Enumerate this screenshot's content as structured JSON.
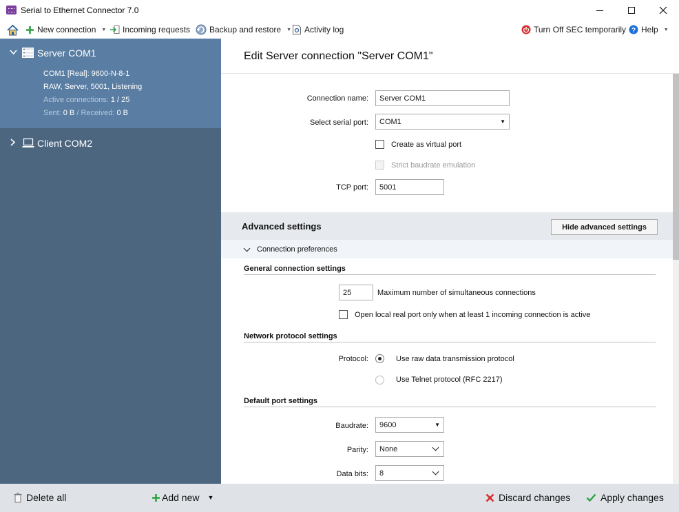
{
  "window": {
    "title": "Serial to Ethernet Connector 7.0"
  },
  "toolbar": {
    "new_connection": "New connection",
    "incoming_requests": "Incoming requests",
    "backup_restore": "Backup and restore",
    "activity_log": "Activity log",
    "turn_off": "Turn Off SEC temporarily",
    "help": "Help"
  },
  "sidebar": {
    "connections": [
      {
        "name": "Server COM1",
        "port_line": "COM1 [Real]: 9600-N-8-1",
        "status_line": "RAW, Server, 5001, Listening",
        "active_label": "Active connections:",
        "active_value": "1 / 25",
        "sent_label": "Sent:",
        "sent_value": "0 B",
        "separator": "/",
        "received_label": "Received:",
        "received_value": "0 B"
      },
      {
        "name": "Client COM2"
      }
    ],
    "footer": {
      "delete_all": "Delete all",
      "add_new": "Add new"
    }
  },
  "main": {
    "title": "Edit Server connection \"Server COM1\"",
    "connection_name_label": "Connection name:",
    "connection_name_value": "Server COM1",
    "serial_port_label": "Select serial port:",
    "serial_port_value": "COM1",
    "virtual_port_label": "Create as virtual port",
    "strict_baud_label": "Strict baudrate emulation",
    "tcp_port_label": "TCP port:",
    "tcp_port_value": "5001",
    "advanced": {
      "title": "Advanced settings",
      "hide_button": "Hide advanced settings",
      "preferences_label": "Connection preferences",
      "general_head": "General connection settings",
      "max_connections_value": "25",
      "max_connections_label": "Maximum number of simultaneous connections",
      "open_local_label": "Open local real port only when at least 1 incoming connection is active",
      "network_head": "Network protocol settings",
      "protocol_label": "Protocol:",
      "raw_protocol": "Use raw data transmission protocol",
      "telnet_protocol": "Use Telnet protocol (RFC 2217)",
      "default_port_head": "Default port settings",
      "baudrate_label": "Baudrate:",
      "baudrate_value": "9600",
      "parity_label": "Parity:",
      "parity_value": "None",
      "databits_label": "Data bits:",
      "databits_value": "8"
    }
  },
  "bottom": {
    "discard": "Discard changes",
    "apply": "Apply changes"
  },
  "colors": {
    "sidebar_bg": "#4c6680",
    "sidebar_selected": "#5a7ea3",
    "accent_green": "#2ea043",
    "accent_red": "#d32f2f"
  }
}
